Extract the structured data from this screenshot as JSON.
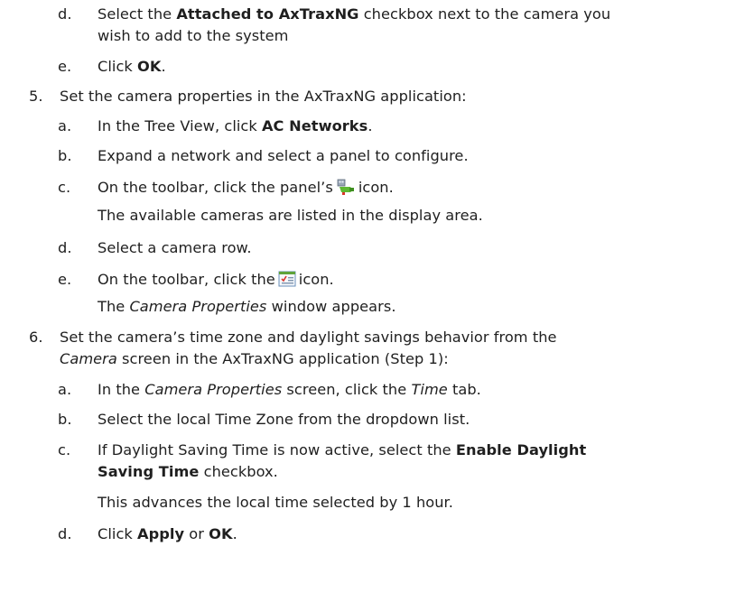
{
  "steps": {
    "s4d": {
      "marker": "d.",
      "p1": "Select the ",
      "b1": "Attached to AxTraxNG",
      "p2": " checkbox next to the camera you",
      "line2": "wish to add to the system"
    },
    "s4e": {
      "marker": "e.",
      "p1": "Click ",
      "b1": "OK",
      "p2": "."
    },
    "s5": {
      "marker": "5.",
      "text": "Set the camera properties in the AxTraxNG application:"
    },
    "s5a": {
      "marker": "a.",
      "p1": "In the Tree View, click ",
      "b1": "AC Networks",
      "p2": "."
    },
    "s5b": {
      "marker": "b.",
      "text": "Expand a network and select a panel to configure."
    },
    "s5c": {
      "marker": "c.",
      "p1": "On the toolbar, click the panel’s",
      "p2": "icon.",
      "note": "The available cameras are listed in the display area.",
      "icon": "panel-camera-icon"
    },
    "s5d": {
      "marker": "d.",
      "text": "Select a camera row."
    },
    "s5e": {
      "marker": "e.",
      "p1": "On the toolbar, click the",
      "p2": "icon.",
      "note_italic": "Camera Properties",
      "note_rest": " window appears.",
      "note_pre": "The ",
      "icon": "properties-icon"
    },
    "s6": {
      "marker": "6.",
      "line1": "Set the camera’s time zone and daylight savings behavior from the",
      "line2_it": "Camera",
      "line2_rest": " screen in the AxTraxNG application (Step 1):"
    },
    "s6a": {
      "marker": "a.",
      "p1": "In the ",
      "i1": "Camera Properties",
      "p2": " screen, click the ",
      "i2": "Time",
      "p3": " tab."
    },
    "s6b": {
      "marker": "b.",
      "text": "Select the local Time Zone from the dropdown list."
    },
    "s6c": {
      "marker": "c.",
      "p1": "If Daylight Saving Time is now active, select the ",
      "b1": "Enable Daylight",
      "b2": "Saving Time",
      "p2": " checkbox.",
      "note": "This advances the local time selected by 1 hour."
    },
    "s6d": {
      "marker": "d.",
      "p1": "Click ",
      "b1": "Apply",
      "p2": " or ",
      "b2": "OK",
      "p3": "."
    }
  },
  "colors": {
    "text": "#1f1f1f",
    "icon_green": "#5fb832",
    "icon_red": "#d9342b"
  }
}
